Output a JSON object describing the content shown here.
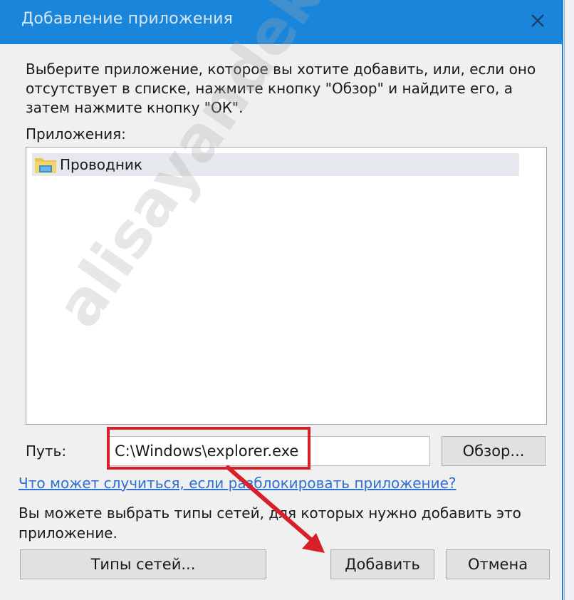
{
  "window": {
    "title": "Добавление приложения",
    "close_glyph": "✕"
  },
  "instruction": "Выберите приложение, которое вы хотите добавить, или, если оно отсутствует в списке, нажмите кнопку \"Обзор\" и найдите его, а затем нажмите кнопку \"ОК\".",
  "apps": {
    "label": "Приложения:",
    "items": [
      {
        "label": "Проводник",
        "icon": "folder-icon",
        "selected": true
      }
    ]
  },
  "path": {
    "label": "Путь:",
    "value": "C:\\Windows\\explorer.exe"
  },
  "buttons": {
    "browse": "Обзор...",
    "network_types": "Типы сетей...",
    "add": "Добавить",
    "cancel": "Отмена"
  },
  "link": "Что может случиться, если разблокировать приложение?",
  "networks_text": "Вы можете выбрать типы сетей, для которых нужно добавить это приложение.",
  "watermark": "alisayandeks.ru",
  "colors": {
    "titlebar": "#1a86db",
    "highlight": "#d8202a",
    "link": "#2e6fd1"
  }
}
